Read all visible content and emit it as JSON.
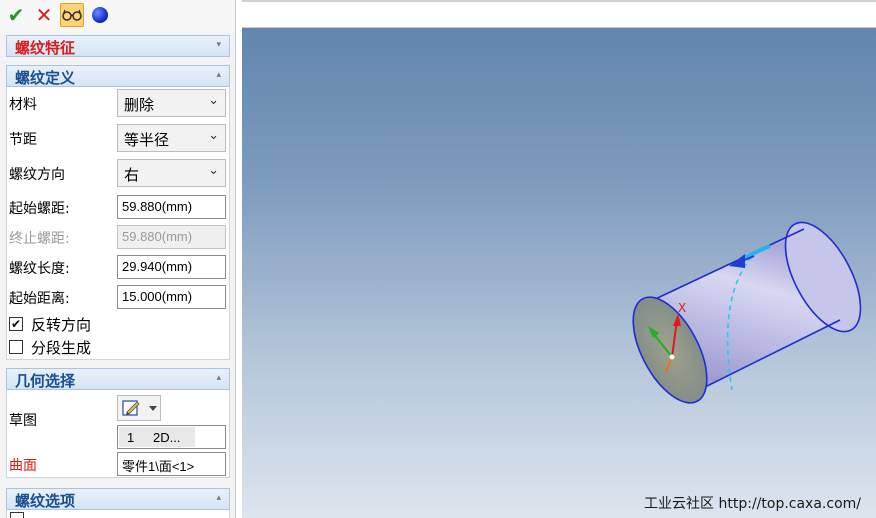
{
  "toolbar": {
    "ok_icon": "check-icon",
    "cancel_icon": "close-icon",
    "preview_icon": "glasses-icon",
    "option_icon": "blue-ball-icon",
    "ok_glyph": "✔",
    "cancel_glyph": "✕"
  },
  "panel": {
    "title": "螺纹特征",
    "thread_definition": {
      "header": "螺纹定义",
      "material_label": "材料",
      "material_value": "删除",
      "pitch_label": "节距",
      "pitch_value": "等半径",
      "direction_label": "螺纹方向",
      "direction_value": "右",
      "start_pitch_label": "起始螺距:",
      "start_pitch_value": "59.880(mm)",
      "end_pitch_label": "终止螺距:",
      "end_pitch_value": "59.880(mm)",
      "length_label": "螺纹长度:",
      "length_value": "29.940(mm)",
      "start_distance_label": "起始距离:",
      "start_distance_value": "15.000(mm)",
      "reverse_label": "反转方向",
      "reverse_checked": true,
      "segment_label": "分段生成",
      "segment_checked": false
    },
    "geometry": {
      "header": "几何选择",
      "sketch_label": "草图",
      "sketch_item_num": "1",
      "sketch_item_text": "2D...",
      "surface_label": "曲面",
      "surface_value": "零件1\\面<1>"
    },
    "thread_options": {
      "header": "螺纹选项"
    },
    "collapse_glyph": "▾",
    "expand_glyph": "▴",
    "dropdown_glyph": "⌄",
    "check_glyph": "✔"
  },
  "viewport": {
    "axis_label": "X",
    "watermark": "工业云社区 http://top.caxa.com/"
  },
  "colors": {
    "accent_red": "#d91c1c",
    "header_blue": "#1a4f8f",
    "cylinder": "#b3b3dd",
    "edge": "#1f2bd6"
  }
}
